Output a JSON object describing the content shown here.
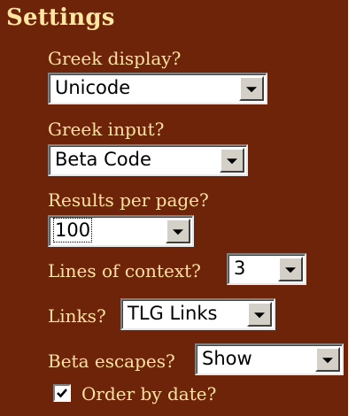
{
  "settings": {
    "title": "Settings",
    "greek_display": {
      "label": "Greek display?",
      "value": "Unicode"
    },
    "greek_input": {
      "label": "Greek input?",
      "value": "Beta Code"
    },
    "results_per_page": {
      "label": "Results per page?",
      "value": "100"
    },
    "lines_of_context": {
      "label": "Lines of context?",
      "value": "3"
    },
    "links": {
      "label": "Links?",
      "value": "TLG Links"
    },
    "beta_escapes": {
      "label": "Beta escapes?",
      "value": "Show"
    },
    "order_by_date": {
      "label": "Order by date?",
      "checked": true
    }
  },
  "colors": {
    "panel_background": "#6e2409",
    "label_text": "#ffe2a3"
  },
  "icons": {
    "dropdown": "chevron-down-icon",
    "checkbox": "checkmark-icon"
  }
}
